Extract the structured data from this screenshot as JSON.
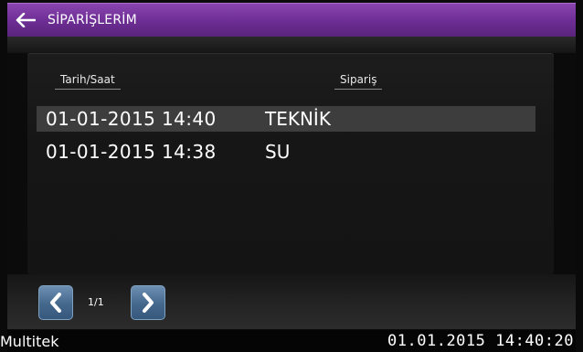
{
  "header": {
    "title": "SİPARİŞLERİM",
    "back_icon": "arrow-left-icon"
  },
  "table": {
    "columns": [
      "Tarih/Saat",
      "Sipariş"
    ],
    "rows": [
      {
        "datetime": "01-01-2015 14:40",
        "order": "TEKNİK",
        "selected": true
      },
      {
        "datetime": "01-01-2015 14:38",
        "order": "SU",
        "selected": false
      }
    ]
  },
  "pagination": {
    "page": "1/1",
    "prev_icon": "chevron-left-icon",
    "next_icon": "chevron-right-icon"
  },
  "status": {
    "brand": "Multitek",
    "datetime": "01.01.2015  14:40:20"
  },
  "colors": {
    "header_purple": "#6c2d93",
    "button_blue": "#44678c",
    "selected_row": "#3d3d3d"
  }
}
